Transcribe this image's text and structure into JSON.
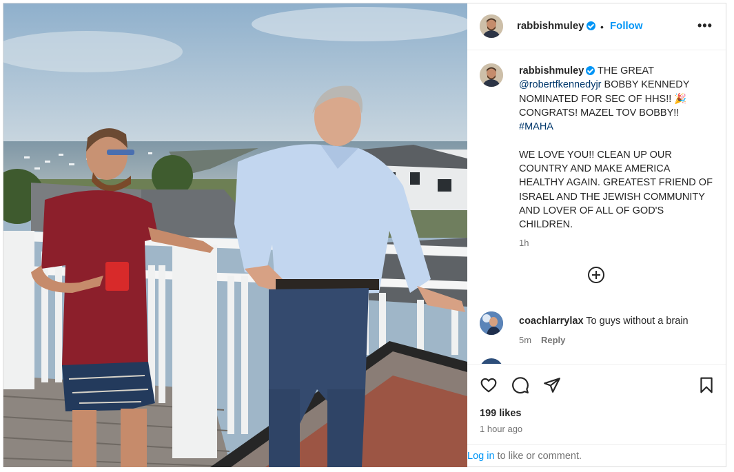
{
  "post": {
    "author": "rabbishmuley",
    "follow_label": "Follow",
    "separator": "•",
    "more_label": "•••"
  },
  "caption": {
    "username": "rabbishmuley",
    "text_before_mention": " THE GREAT ",
    "mention": "@robertfkennedyjr",
    "text_after_mention": " BOBBY KENNEDY NOMINATED FOR SEC OF HHS!! 🎉 CONGRATS! MAZEL TOV BOBBY!! ",
    "hashtag": "#MAHA",
    "paragraph2": "WE LOVE YOU!! CLEAN UP OUR COUNTRY AND MAKE AMERICA HEALTHY AGAIN. GREATEST FRIEND OF ISRAEL AND THE JEWISH COMMUNITY AND LOVER OF ALL OF GOD'S CHILDREN.",
    "time": "1h"
  },
  "comments": [
    {
      "username": "coachlarrylax",
      "text": "To guys without a brain",
      "time": "5m",
      "reply_label": "Reply"
    }
  ],
  "icons": {
    "like": "heart-icon",
    "comment": "comment-icon",
    "share": "share-icon",
    "save": "bookmark-icon",
    "load_more": "plus-circle-icon",
    "verified": "verified-badge-icon"
  },
  "stats": {
    "likes": "199 likes",
    "posted": "1 hour ago"
  },
  "login": {
    "link": "Log in",
    "text": " to like or comment."
  },
  "colors": {
    "accent": "#0095f6",
    "link": "#00376b",
    "secondary_text": "#737373"
  }
}
